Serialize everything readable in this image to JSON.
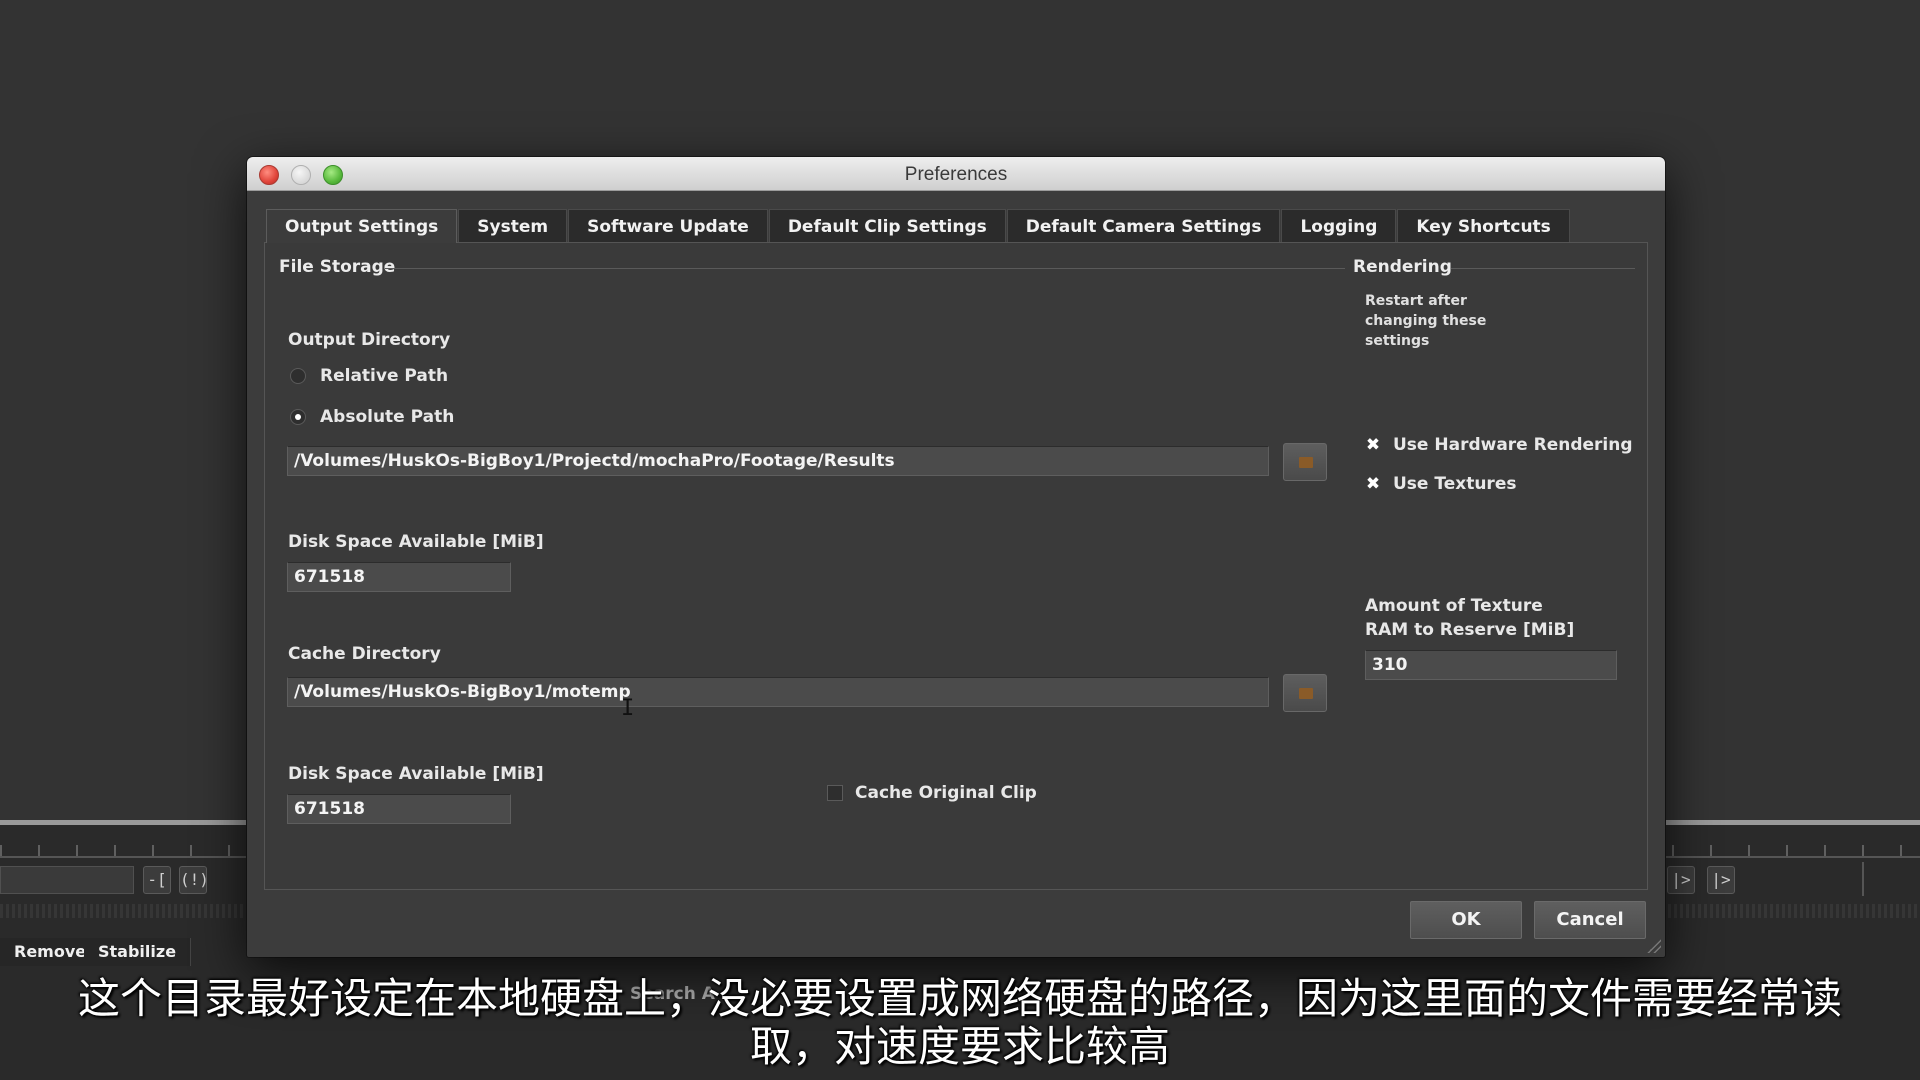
{
  "background": {
    "toolbar_icons": [
      "-[",
      "(!)",
      "|>",
      "|>"
    ],
    "bottom_tabs": [
      "Remove",
      "Stabilize"
    ],
    "search_partial": "Search A"
  },
  "dialog": {
    "title": "Preferences",
    "tabs": [
      {
        "label": "Output Settings",
        "active": true
      },
      {
        "label": "System",
        "active": false
      },
      {
        "label": "Software Update",
        "active": false
      },
      {
        "label": "Default Clip Settings",
        "active": false
      },
      {
        "label": "Default Camera Settings",
        "active": false
      },
      {
        "label": "Logging",
        "active": false
      },
      {
        "label": "Key Shortcuts",
        "active": false
      }
    ],
    "file_storage": {
      "title": "File Storage",
      "output_directory_label": "Output Directory",
      "relative_path_label": "Relative Path",
      "absolute_path_label": "Absolute Path",
      "selected_path_mode": "Absolute Path",
      "output_path": "/Volumes/HuskOs-BigBoy1/Projectd/mochaPro/Footage/Results",
      "disk_space_label_1": "Disk Space Available [MiB]",
      "disk_space_value_1": "671518",
      "cache_directory_label": "Cache Directory",
      "cache_path": "/Volumes/HuskOs-BigBoy1/motemp",
      "disk_space_label_2": "Disk Space Available [MiB]",
      "disk_space_value_2": "671518",
      "cache_original_clip_label": "Cache Original Clip",
      "cache_original_clip_checked": false
    },
    "rendering": {
      "title": "Rendering",
      "note": "Restart after changing these settings",
      "use_hardware_rendering_label": "Use Hardware Rendering",
      "use_hardware_rendering_checked": true,
      "use_textures_label": "Use Textures",
      "use_textures_checked": true,
      "texture_ram_label_line1": "Amount of Texture",
      "texture_ram_label_line2": "RAM to Reserve [MiB]",
      "texture_ram_value": "310"
    },
    "buttons": {
      "ok": "OK",
      "cancel": "Cancel"
    }
  },
  "subtitle": {
    "line1": "这个目录最好设定在本地硬盘上，没必要设置成网络硬盘的路径，因为这里面的文件需要经常读",
    "line2": "取，对速度要求比较高"
  },
  "colors": {
    "dialog_bg": "#3c3c3c",
    "field_bg": "#4b4b4b",
    "folder_accent": "#8a5b28",
    "close_red": "#e0443a",
    "zoom_green": "#58b93c"
  }
}
